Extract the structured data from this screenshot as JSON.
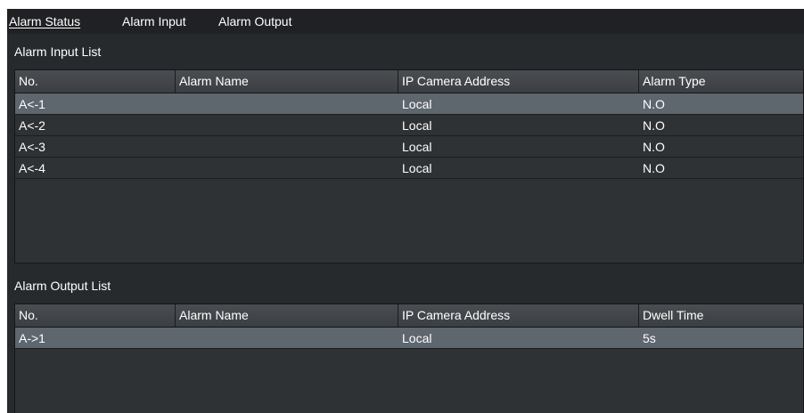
{
  "tabs": [
    {
      "label": "Alarm Status"
    },
    {
      "label": "Alarm Input"
    },
    {
      "label": "Alarm Output"
    }
  ],
  "input_section": {
    "title": "Alarm Input List",
    "columns": [
      "No.",
      "Alarm Name",
      "IP Camera Address",
      "Alarm Type"
    ],
    "rows": [
      {
        "no": "A<-1",
        "name": "",
        "address": "Local",
        "type": "N.O"
      },
      {
        "no": "A<-2",
        "name": "",
        "address": "Local",
        "type": "N.O"
      },
      {
        "no": "A<-3",
        "name": "",
        "address": "Local",
        "type": "N.O"
      },
      {
        "no": "A<-4",
        "name": "",
        "address": "Local",
        "type": "N.O"
      }
    ]
  },
  "output_section": {
    "title": "Alarm Output List",
    "columns": [
      "No.",
      "Alarm Name",
      "IP Camera Address",
      "Dwell Time"
    ],
    "rows": [
      {
        "no": "A->1",
        "name": "",
        "address": "Local",
        "dwell": "5s"
      }
    ]
  },
  "colors": {
    "panel": "#272a2d",
    "selected_row": "#5e666e",
    "text": "#ffffff"
  }
}
